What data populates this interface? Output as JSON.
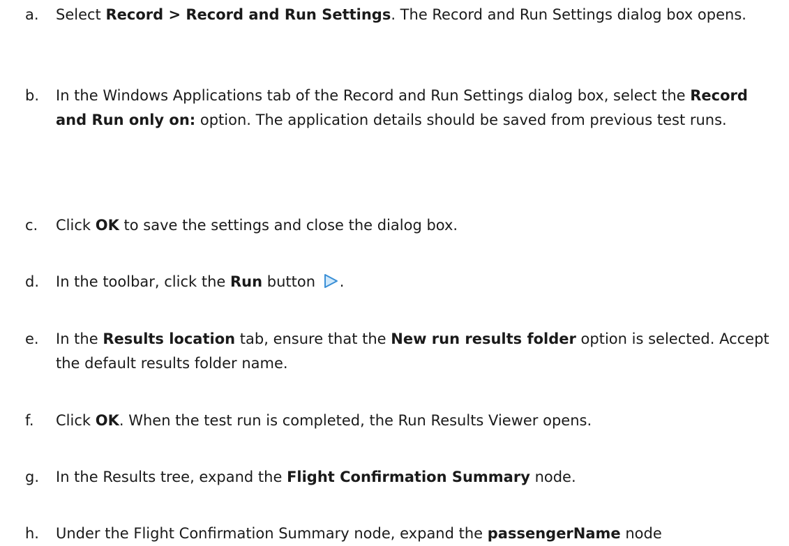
{
  "steps": [
    {
      "marker": "a.",
      "parts": [
        {
          "text": "Select "
        },
        {
          "text": "Record > Record and Run Settings",
          "bold": true
        },
        {
          "text": ". The Record and Run Settings dialog box opens."
        }
      ]
    },
    {
      "marker": "b.",
      "parts": [
        {
          "text": "In the Windows Applications tab of the Record and Run Settings dialog box, select the "
        },
        {
          "text": "Record and Run only on:",
          "bold": true
        },
        {
          "text": " option. The application details should be saved from previous test runs."
        }
      ]
    },
    {
      "marker": "c.",
      "parts": [
        {
          "text": "Click "
        },
        {
          "text": "OK",
          "bold": true
        },
        {
          "text": " to save the settings and close the dialog box."
        }
      ]
    },
    {
      "marker": "d.",
      "parts": [
        {
          "text": "In the toolbar, click the "
        },
        {
          "text": "Run",
          "bold": true
        },
        {
          "text": " button "
        },
        {
          "icon": "run-icon"
        },
        {
          "text": "."
        }
      ]
    },
    {
      "marker": "e.",
      "parts": [
        {
          "text": "In the "
        },
        {
          "text": "Results location",
          "bold": true
        },
        {
          "text": " tab, ensure that the "
        },
        {
          "text": "New run results folder",
          "bold": true
        },
        {
          "text": " option is selected. Accept the default results folder name."
        }
      ]
    },
    {
      "marker": "f.",
      "parts": [
        {
          "text": "Click "
        },
        {
          "text": "OK",
          "bold": true
        },
        {
          "text": ". When the test run is completed, the Run Results Viewer opens."
        }
      ]
    },
    {
      "marker": "g.",
      "parts": [
        {
          "text": "In the Results tree, expand the "
        },
        {
          "text": "Flight Confirmation Summary",
          "bold": true
        },
        {
          "text": " node."
        }
      ]
    },
    {
      "marker": "h.",
      "parts": [
        {
          "text": "Under the Flight Confirmation Summary node, expand the "
        },
        {
          "text": "passengerName",
          "bold": true
        },
        {
          "text": " node"
        }
      ]
    }
  ],
  "colors": {
    "text": "#1a1a1a",
    "run_icon_fill": "#cfe8fb",
    "run_icon_stroke": "#3a8fd6"
  }
}
